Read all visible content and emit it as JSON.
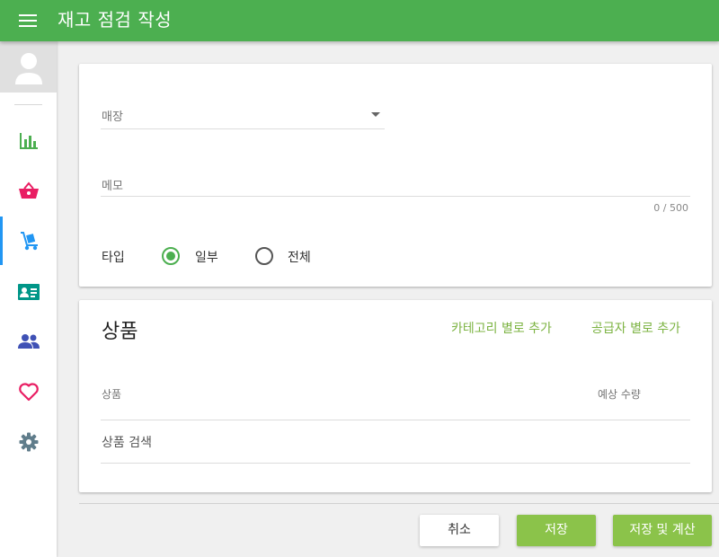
{
  "header": {
    "title": "재고 점검 작성",
    "accent": "#4caf50"
  },
  "sidebar": {
    "items": [
      {
        "icon": "bar-chart-icon",
        "color": "#4caf50",
        "active": false
      },
      {
        "icon": "basket-icon",
        "color": "#e91e63",
        "active": false
      },
      {
        "icon": "hand-truck-icon",
        "color": "#2196f3",
        "active": true
      },
      {
        "icon": "id-card-icon",
        "color": "#009688",
        "active": false
      },
      {
        "icon": "people-icon",
        "color": "#3f51b5",
        "active": false
      },
      {
        "icon": "heart-icon",
        "color": "#e91e63",
        "active": false
      },
      {
        "icon": "gear-icon",
        "color": "#607d8b",
        "active": false
      }
    ]
  },
  "form": {
    "store_label": "매장",
    "memo_label": "메모",
    "memo_counter": "0 / 500",
    "type_label": "타입",
    "type_options": [
      {
        "label": "일부",
        "selected": true
      },
      {
        "label": "전체",
        "selected": false
      }
    ]
  },
  "products": {
    "title": "상품",
    "add_by_category": "카테고리 별로 추가",
    "add_by_supplier": "공급자 별로 추가",
    "columns": [
      "상품",
      "예상 수량"
    ],
    "search_placeholder": "상품 검색"
  },
  "actions": {
    "cancel": "취소",
    "save": "저장",
    "save_and_calculate": "저장 및 계산"
  }
}
